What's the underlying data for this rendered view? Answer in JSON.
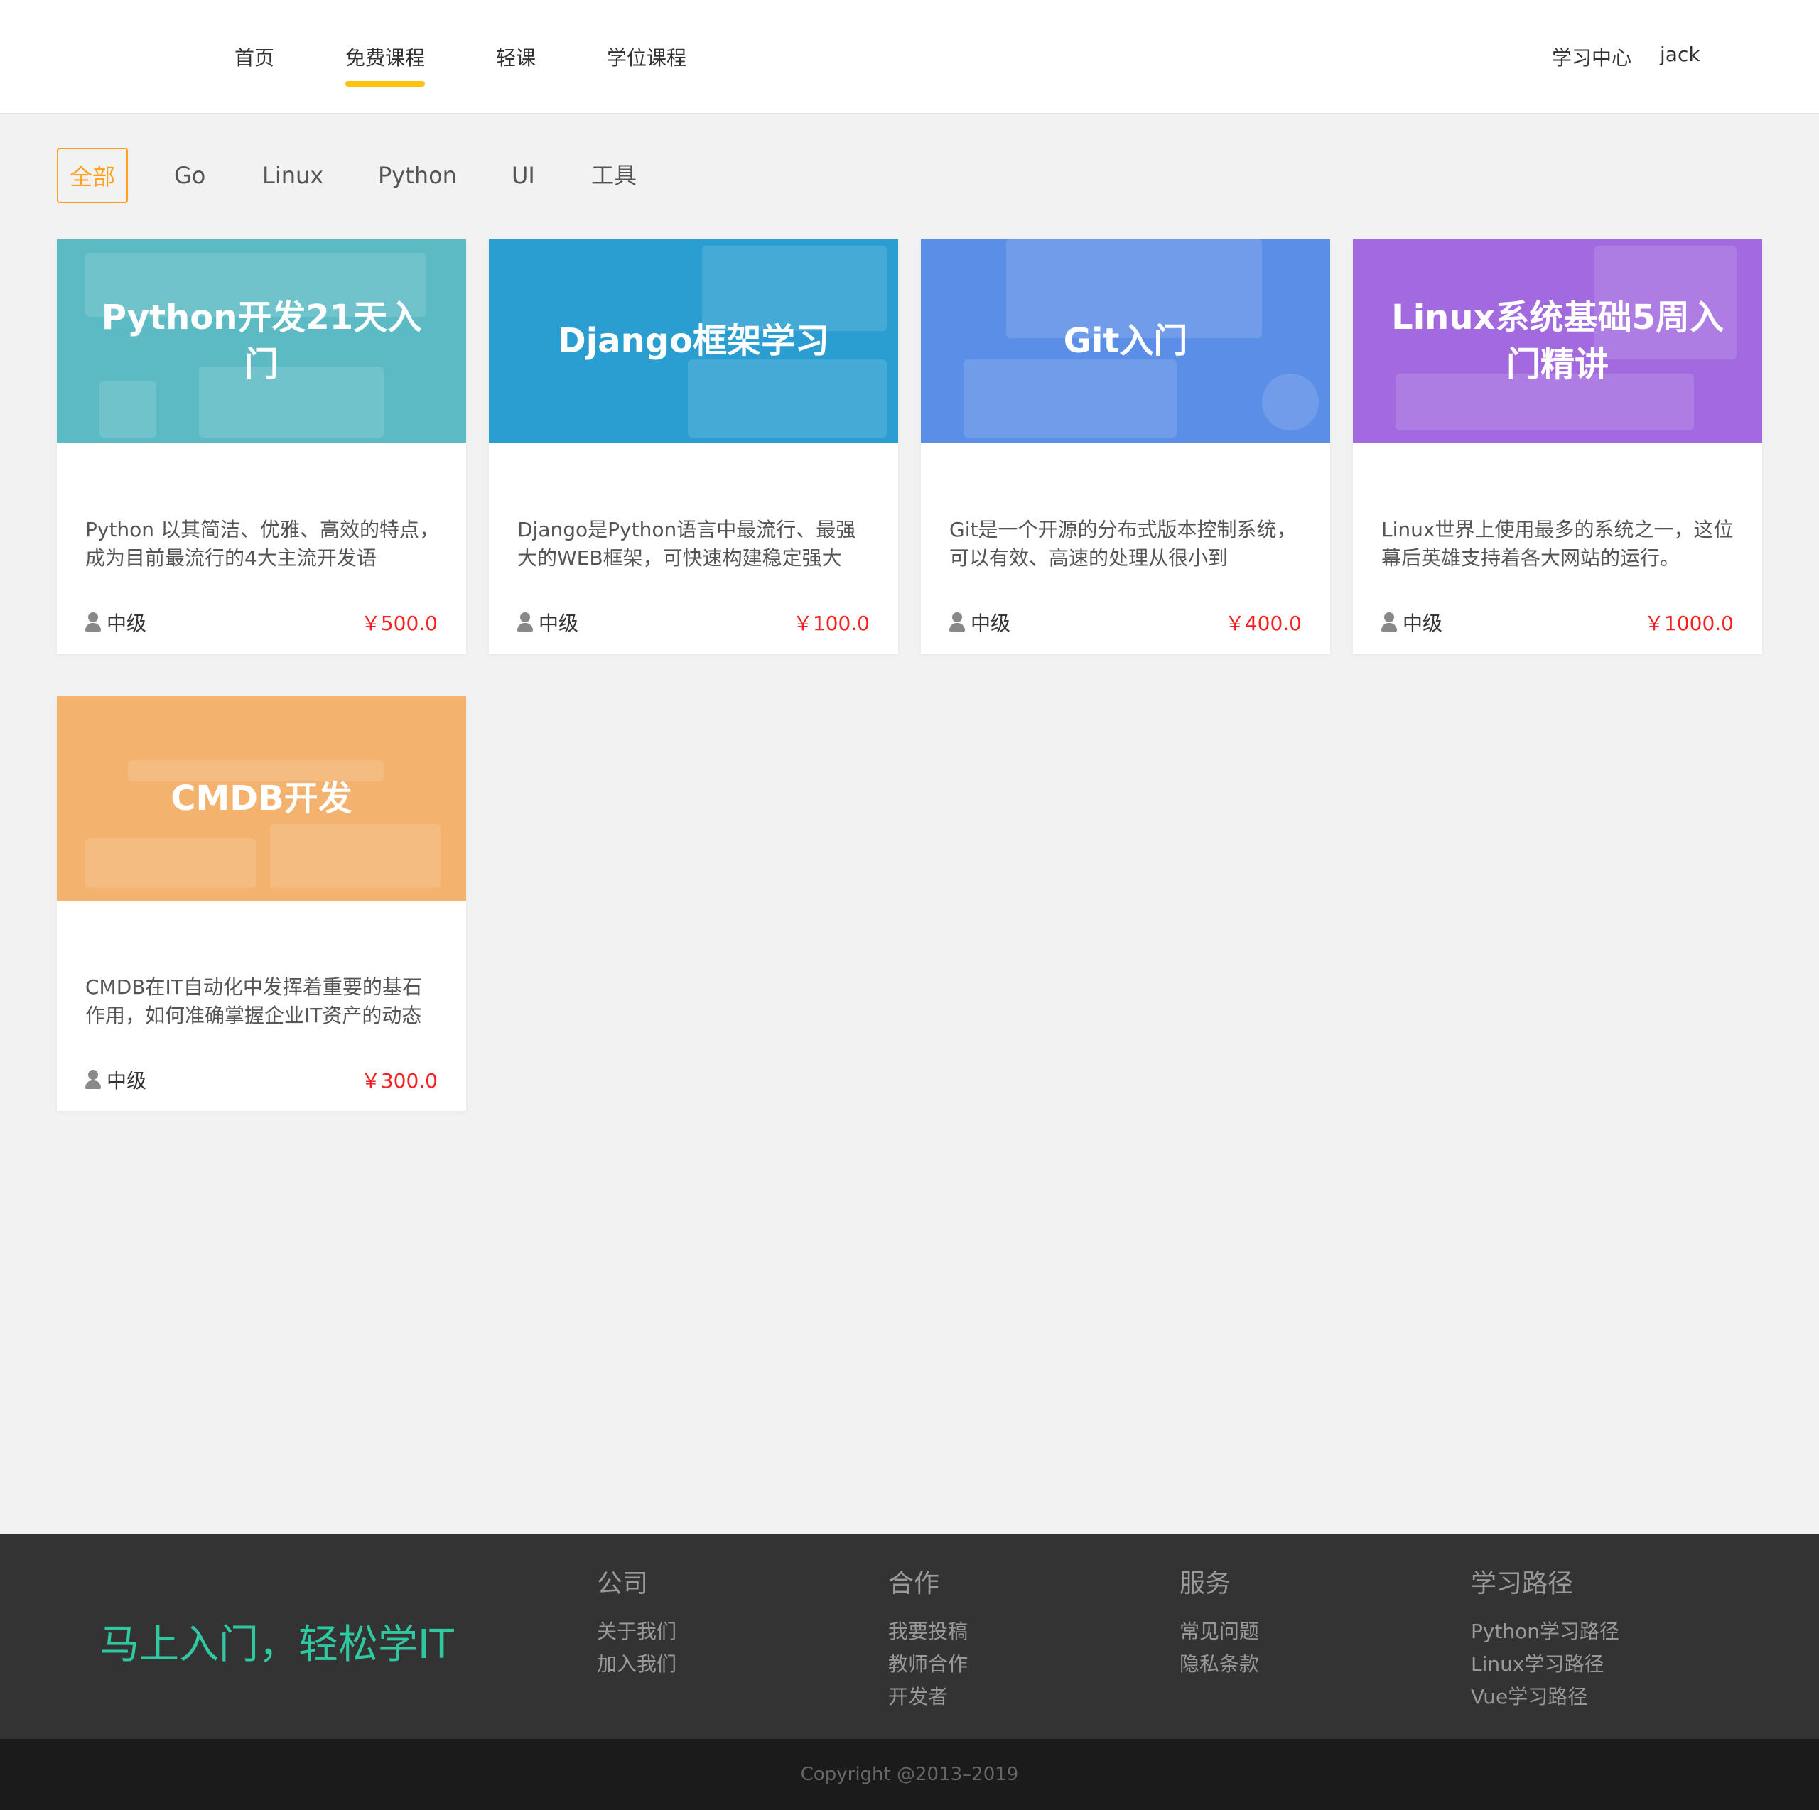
{
  "header": {
    "nav": [
      "首页",
      "免费课程",
      "轻课",
      "学位课程"
    ],
    "active_nav": "免费课程",
    "learning_center": "学习中心",
    "username": "jack",
    "accent_color": "#ffc210"
  },
  "filters": {
    "items": [
      "全部",
      "Go",
      "Linux",
      "Python",
      "UI",
      "工具"
    ],
    "active": "全部",
    "active_color": "#ffa11a"
  },
  "courses": [
    {
      "title": "Python开发21天入门",
      "banner_color": "#5bbac3",
      "description": "Python 以其简洁、优雅、高效的特点，成为目前最流行的4大主流开发语",
      "level": "中级",
      "price": "￥500.0"
    },
    {
      "title": "Django框架学习",
      "banner_color": "#2a9ed0",
      "description": "Django是Python语言中最流行、最强大的WEB框架，可快速构建稳定强大",
      "level": "中级",
      "price": "￥100.0"
    },
    {
      "title": "Git入门",
      "banner_color": "#5b8ee6",
      "description": "Git是一个开源的分布式版本控制系统，可以有效、高速的处理从很小到",
      "level": "中级",
      "price": "￥400.0"
    },
    {
      "title": "Linux系统基础5周入门精讲",
      "banner_color": "#a36ae0",
      "description": "Linux世界上使用最多的系统之一，这位幕后英雄支持着各大网站的运行。",
      "level": "中级",
      "price": "￥1000.0"
    },
    {
      "title": "CMDB开发",
      "banner_color": "#f4b26f",
      "description": "CMDB在IT自动化中发挥着重要的基石作用，如何准确掌握企业IT资产的动态",
      "level": "中级",
      "price": "￥300.0"
    }
  ],
  "footer": {
    "slogan": "马上入门，轻松学IT",
    "columns": [
      {
        "title": "公司",
        "links": [
          "关于我们",
          "加入我们"
        ]
      },
      {
        "title": "合作",
        "links": [
          "我要投稿",
          "教师合作",
          "开发者"
        ]
      },
      {
        "title": "服务",
        "links": [
          "常见问题",
          "隐私条款"
        ]
      },
      {
        "title": "学习路径",
        "links": [
          "Python学习路径",
          "Linux学习路径",
          "Vue学习路径"
        ]
      }
    ],
    "copyright": "Copyright @2013–2019"
  }
}
